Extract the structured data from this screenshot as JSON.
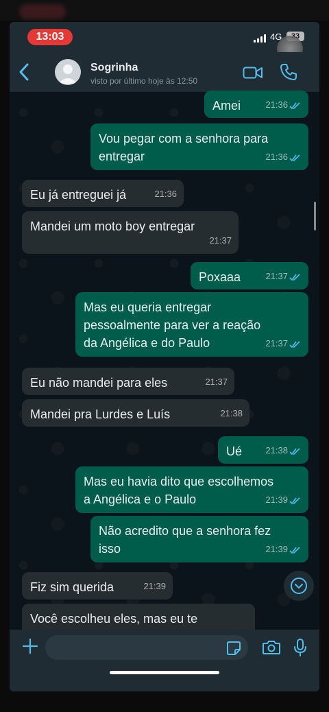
{
  "status_bar": {
    "time": "13:03",
    "network": "4G",
    "battery": "33"
  },
  "header": {
    "contact_name": "Sogrinha",
    "contact_status": "visto por último hoje às 12:50"
  },
  "messages": [
    {
      "dir": "out",
      "text": "Amei",
      "time": "21:36"
    },
    {
      "dir": "out",
      "text": "Vou pegar com a senhora para\nentregar",
      "time": "21:36"
    },
    {
      "dir": "in",
      "text": "Eu já entreguei já",
      "time": "21:36"
    },
    {
      "dir": "in",
      "text": "Mandei um moto boy entregar",
      "time": "21:37"
    },
    {
      "dir": "out",
      "text": "Poxaaa",
      "time": "21:37"
    },
    {
      "dir": "out",
      "text": "Mas eu queria entregar\npessoalmente para ver a reação\nda Angélica e do Paulo",
      "time": "21:37"
    },
    {
      "dir": "in",
      "text": "Eu não mandei para eles",
      "time": "21:37"
    },
    {
      "dir": "in",
      "text": "Mandei pra Lurdes e Luís",
      "time": "21:38"
    },
    {
      "dir": "out",
      "text": "Ué",
      "time": "21:38"
    },
    {
      "dir": "out",
      "text": "Mas eu havia dito que escolhemos\na Angélica e o Paulo",
      "time": "21:39"
    },
    {
      "dir": "out",
      "text": "Não acredito que a senhora fez\nisso",
      "time": "21:39"
    },
    {
      "dir": "in",
      "text": "Fiz sim querida",
      "time": "21:39"
    },
    {
      "dir": "in",
      "text": "Você escolheu eles, mas eu te",
      "time": ""
    }
  ],
  "input": {
    "placeholder": ""
  },
  "colors": {
    "outgoing": "#005c4b",
    "incoming": "#262d31",
    "accent": "#53bdeb",
    "read_tick": "#53bdeb"
  }
}
